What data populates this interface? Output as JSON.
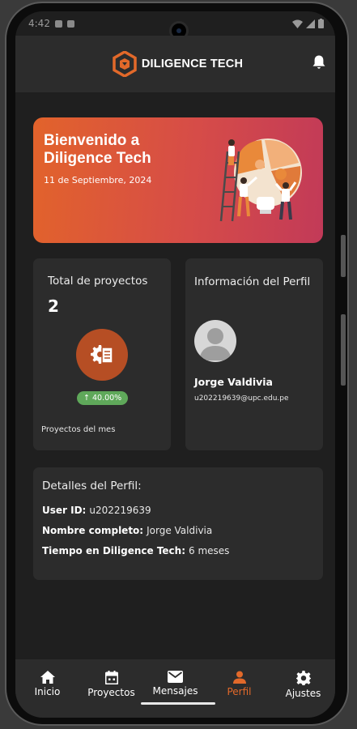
{
  "status": {
    "time": "4:42"
  },
  "app": {
    "brand": "DILIGENCE TECH"
  },
  "banner": {
    "title": "Bienvenido a Diligence Tech",
    "date": "11 de Septiembre, 2024"
  },
  "projects_card": {
    "title": "Total de proyectos",
    "count": "2",
    "badge": "↑ 40.00%",
    "footer": "Proyectos del mes",
    "icon": "gear-document-icon"
  },
  "profile_card": {
    "title": "Información del Perfil",
    "name": "Jorge Valdivia",
    "email": "u202219639@upc.edu.pe"
  },
  "details": {
    "title": "Detalles del Perfil:",
    "rows": [
      {
        "label": "User ID:",
        "value": "u202219639"
      },
      {
        "label": "Nombre completo:",
        "value": "Jorge Valdivia"
      },
      {
        "label": "Tiempo en Diligence Tech:",
        "value": "6 meses"
      }
    ]
  },
  "nav": {
    "items": [
      {
        "label": "Inicio",
        "icon": "home-icon"
      },
      {
        "label": "Proyectos",
        "icon": "calendar-icon"
      },
      {
        "label": "Mensajes",
        "icon": "mail-icon"
      },
      {
        "label": "Perfil",
        "icon": "person-icon",
        "active": true
      },
      {
        "label": "Ajustes",
        "icon": "gear-icon"
      }
    ]
  },
  "colors": {
    "accent": "#e2692a",
    "background": "#1f1f1f",
    "card": "#2c2c2c",
    "badge": "#5fa85a"
  }
}
